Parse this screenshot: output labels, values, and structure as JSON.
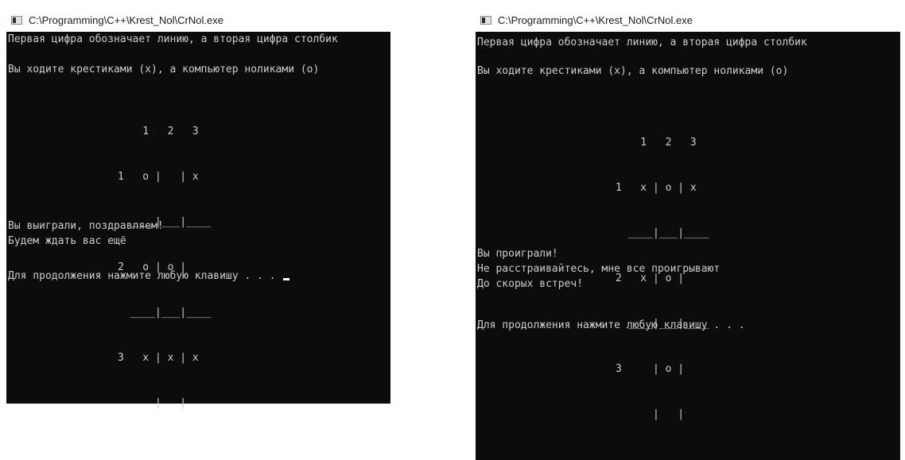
{
  "windows": [
    {
      "title": "C:\\Programming\\C++\\Krest_Nol\\CrNol.exe",
      "intro_line1": "Первая цифра обозначает линию, а вторая цифра столбик",
      "intro_line2": "Вы ходите крестиками (х), а компьютер ноликами (о)",
      "board": {
        "header": "    1   2   3",
        "rows": [
          "1   o |   | x",
          "  ____|___|____",
          "2   o | o |",
          "  ____|___|____",
          "3   x | x | x",
          "      |   |"
        ]
      },
      "result_line1": "Вы выиграли, поздравляем!",
      "result_line2": "Будем ждать вас ещё",
      "prompt": "Для продолжения нажмите любую клавишу . . . "
    },
    {
      "title": "C:\\Programming\\C++\\Krest_Nol\\CrNol.exe",
      "intro_line1": "Первая цифра обозначает линию, а вторая цифра столбик",
      "intro_line2": "Вы ходите крестиками (х), а компьютер ноликами (о)",
      "board": {
        "header": "    1   2   3",
        "rows": [
          "1   x | o | x",
          "  ____|___|____",
          "2   x | o |",
          "  ____|___|____",
          "3     | o |",
          "      |   |"
        ]
      },
      "result_line1": "Вы проиграли!",
      "result_line2": "Не расстраивайтесь, мне все проигрывают",
      "result_line3": "До скорых встреч!",
      "prompt": "Для продолжения нажмите любую клавишу . . ."
    }
  ]
}
